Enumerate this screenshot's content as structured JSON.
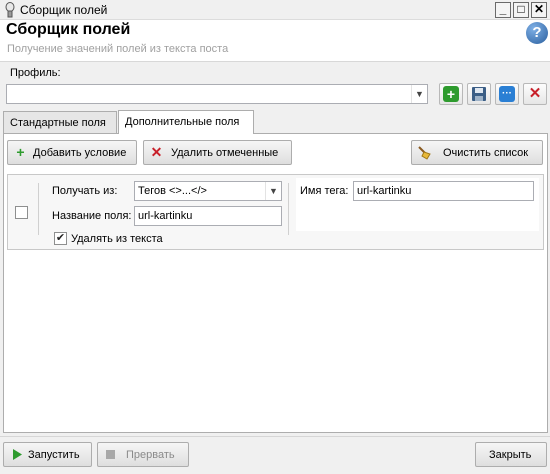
{
  "window": {
    "title": "Сборщик полей",
    "minimize": "_",
    "maximize": "□",
    "close": "✕"
  },
  "header": {
    "title": "Сборщик полей",
    "subtitle": "Получение значений полей из текста поста",
    "help_symbol": "?"
  },
  "profile": {
    "label": "Профиль:",
    "value": "",
    "dropdown_arrow": "▼"
  },
  "toolbar": {
    "add_symbol": "+",
    "more_symbol": "···",
    "delete_symbol": "✕"
  },
  "tabs": [
    {
      "label": "Стандартные поля",
      "active": false
    },
    {
      "label": "Дополнительные поля",
      "active": true
    }
  ],
  "actions": {
    "add_condition": "Добавить условие",
    "delete_selected": "Удалить отмеченные",
    "clear_list": "Очистить список"
  },
  "condition": {
    "source_label": "Получать из:",
    "source_value": "Тегов <>...</>",
    "field_name_label": "Название поля:",
    "field_name_value": "url-kartinku",
    "remove_from_text_label": "Удалять из текста",
    "remove_from_text_checked": true,
    "row_checked": false,
    "tag_name_label": "Имя тега:",
    "tag_name_value": "url-kartinku"
  },
  "footer": {
    "run": "Запустить",
    "interrupt": "Прервать",
    "close": "Закрыть"
  },
  "colors": {
    "add_green": "#2e9b2e",
    "more_blue": "#2a7fd4",
    "delete_red": "#c8202a",
    "header_subtitle": "#a0a0a0"
  }
}
